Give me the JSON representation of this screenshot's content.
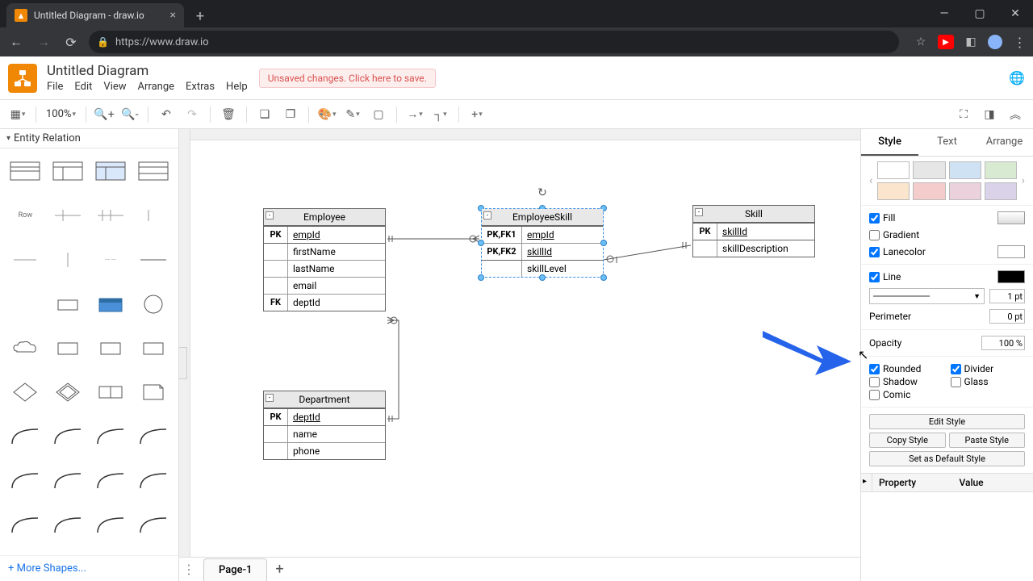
{
  "browser": {
    "tab_title": "Untitled Diagram - draw.io",
    "url": "https://www.draw.io"
  },
  "app": {
    "title": "Untitled Diagram",
    "menus": [
      "File",
      "Edit",
      "View",
      "Arrange",
      "Extras",
      "Help"
    ],
    "unsaved_msg": "Unsaved changes. Click here to save.",
    "zoom": "100%"
  },
  "palette": {
    "title": "Entity Relation",
    "row_label": "Row",
    "more_shapes": "+ More Shapes..."
  },
  "tables": {
    "employee": {
      "title": "Employee",
      "rows": [
        {
          "key": "PK",
          "field": "empId",
          "u": true
        },
        {
          "key": "",
          "field": "firstName"
        },
        {
          "key": "",
          "field": "lastName"
        },
        {
          "key": "",
          "field": "email"
        },
        {
          "key": "FK",
          "field": "deptId"
        }
      ]
    },
    "employeeSkill": {
      "title": "EmployeeSkill",
      "rows": [
        {
          "key": "PK,FK1",
          "field": "empId",
          "u": true
        },
        {
          "key": "PK,FK2",
          "field": "skillId",
          "u": true
        },
        {
          "key": "",
          "field": "skillLevel"
        }
      ]
    },
    "skill": {
      "title": "Skill",
      "rows": [
        {
          "key": "PK",
          "field": "skillId",
          "u": true
        },
        {
          "key": "",
          "field": "skillDescription"
        }
      ]
    },
    "department": {
      "title": "Department",
      "rows": [
        {
          "key": "PK",
          "field": "deptId",
          "u": true
        },
        {
          "key": "",
          "field": "name"
        },
        {
          "key": "",
          "field": "phone"
        }
      ]
    }
  },
  "style_panel": {
    "tabs": [
      "Style",
      "Text",
      "Arrange"
    ],
    "active_tab": 0,
    "swatches": [
      "#ffffff",
      "#e6e6e6",
      "#cfe2f3",
      "#d9ead3",
      "#fce5cd",
      "#f4cccc",
      "#ead1dc",
      "#d9d2e9"
    ],
    "fill": {
      "label": "Fill",
      "checked": true
    },
    "gradient": {
      "label": "Gradient",
      "checked": false
    },
    "lanecolor": {
      "label": "Lanecolor",
      "checked": true
    },
    "line": {
      "label": "Line",
      "checked": true,
      "width": "1 pt"
    },
    "perimeter": {
      "label": "Perimeter",
      "value": "0 pt"
    },
    "opacity": {
      "label": "Opacity",
      "value": "100 %"
    },
    "checks": {
      "rounded": {
        "label": "Rounded",
        "checked": true
      },
      "divider": {
        "label": "Divider",
        "checked": true
      },
      "shadow": {
        "label": "Shadow",
        "checked": false
      },
      "glass": {
        "label": "Glass",
        "checked": false
      },
      "comic": {
        "label": "Comic",
        "checked": false
      }
    },
    "buttons": {
      "edit": "Edit Style",
      "copy": "Copy Style",
      "paste": "Paste Style",
      "default": "Set as Default Style"
    },
    "prop_headers": [
      "Property",
      "Value"
    ]
  },
  "page_tab": "Page-1"
}
